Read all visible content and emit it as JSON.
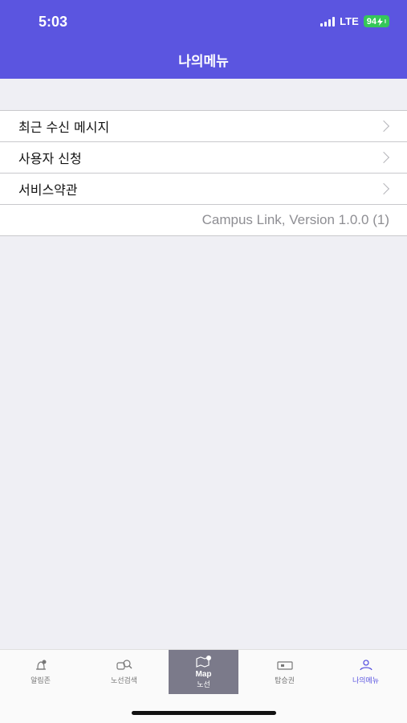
{
  "status_bar": {
    "time": "5:03",
    "network": "LTE",
    "battery": "94"
  },
  "header": {
    "title": "나의메뉴"
  },
  "menu": {
    "items": [
      {
        "label": "최근 수신 메시지"
      },
      {
        "label": "사용자 신청"
      },
      {
        "label": "서비스약관"
      }
    ],
    "version": "Campus Link, Version 1.0.0 (1)"
  },
  "tabbar": {
    "tabs": [
      {
        "label": "알림존",
        "icon": "bell-icon"
      },
      {
        "label": "노선검색",
        "icon": "bus-search-icon"
      },
      {
        "label": "Map",
        "sublabel": "노선",
        "icon": "map-pin-icon"
      },
      {
        "label": "탑승권",
        "icon": "ticket-icon"
      },
      {
        "label": "나의메뉴",
        "icon": "user-menu-icon"
      }
    ],
    "active_tab": "나의메뉴"
  },
  "colors": {
    "accent": "#5b55e0",
    "background": "#efeff4",
    "battery": "#35c759"
  }
}
